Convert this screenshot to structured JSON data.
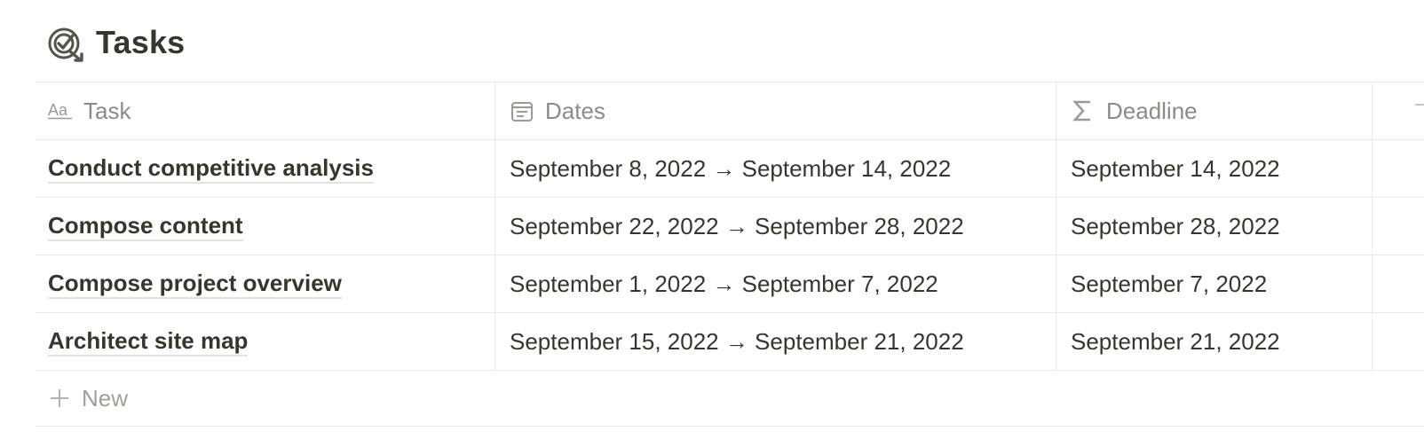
{
  "page": {
    "title": "Tasks",
    "icon": "target-arrow-icon"
  },
  "table": {
    "columns": [
      {
        "label": "Task",
        "icon": "text-aa-icon"
      },
      {
        "label": "Dates",
        "icon": "calendar-icon"
      },
      {
        "label": "Deadline",
        "icon": "sigma-icon"
      }
    ],
    "rows": [
      {
        "task": "Conduct competitive analysis",
        "dates": "September 8, 2022 → September 14, 2022",
        "deadline": "September 14, 2022"
      },
      {
        "task": "Compose content",
        "dates": "September 22, 2022 → September 28, 2022",
        "deadline": "September 28, 2022"
      },
      {
        "task": "Compose project overview",
        "dates": "September 1, 2022 → September 7, 2022",
        "deadline": "September 7, 2022"
      },
      {
        "task": "Architect site map",
        "dates": "September 15, 2022 → September 21, 2022",
        "deadline": "September 21, 2022"
      }
    ],
    "new_label": "New"
  },
  "colors": {
    "text": "#37352f",
    "muted": "#8c8b87",
    "border": "#e9e9e7"
  }
}
